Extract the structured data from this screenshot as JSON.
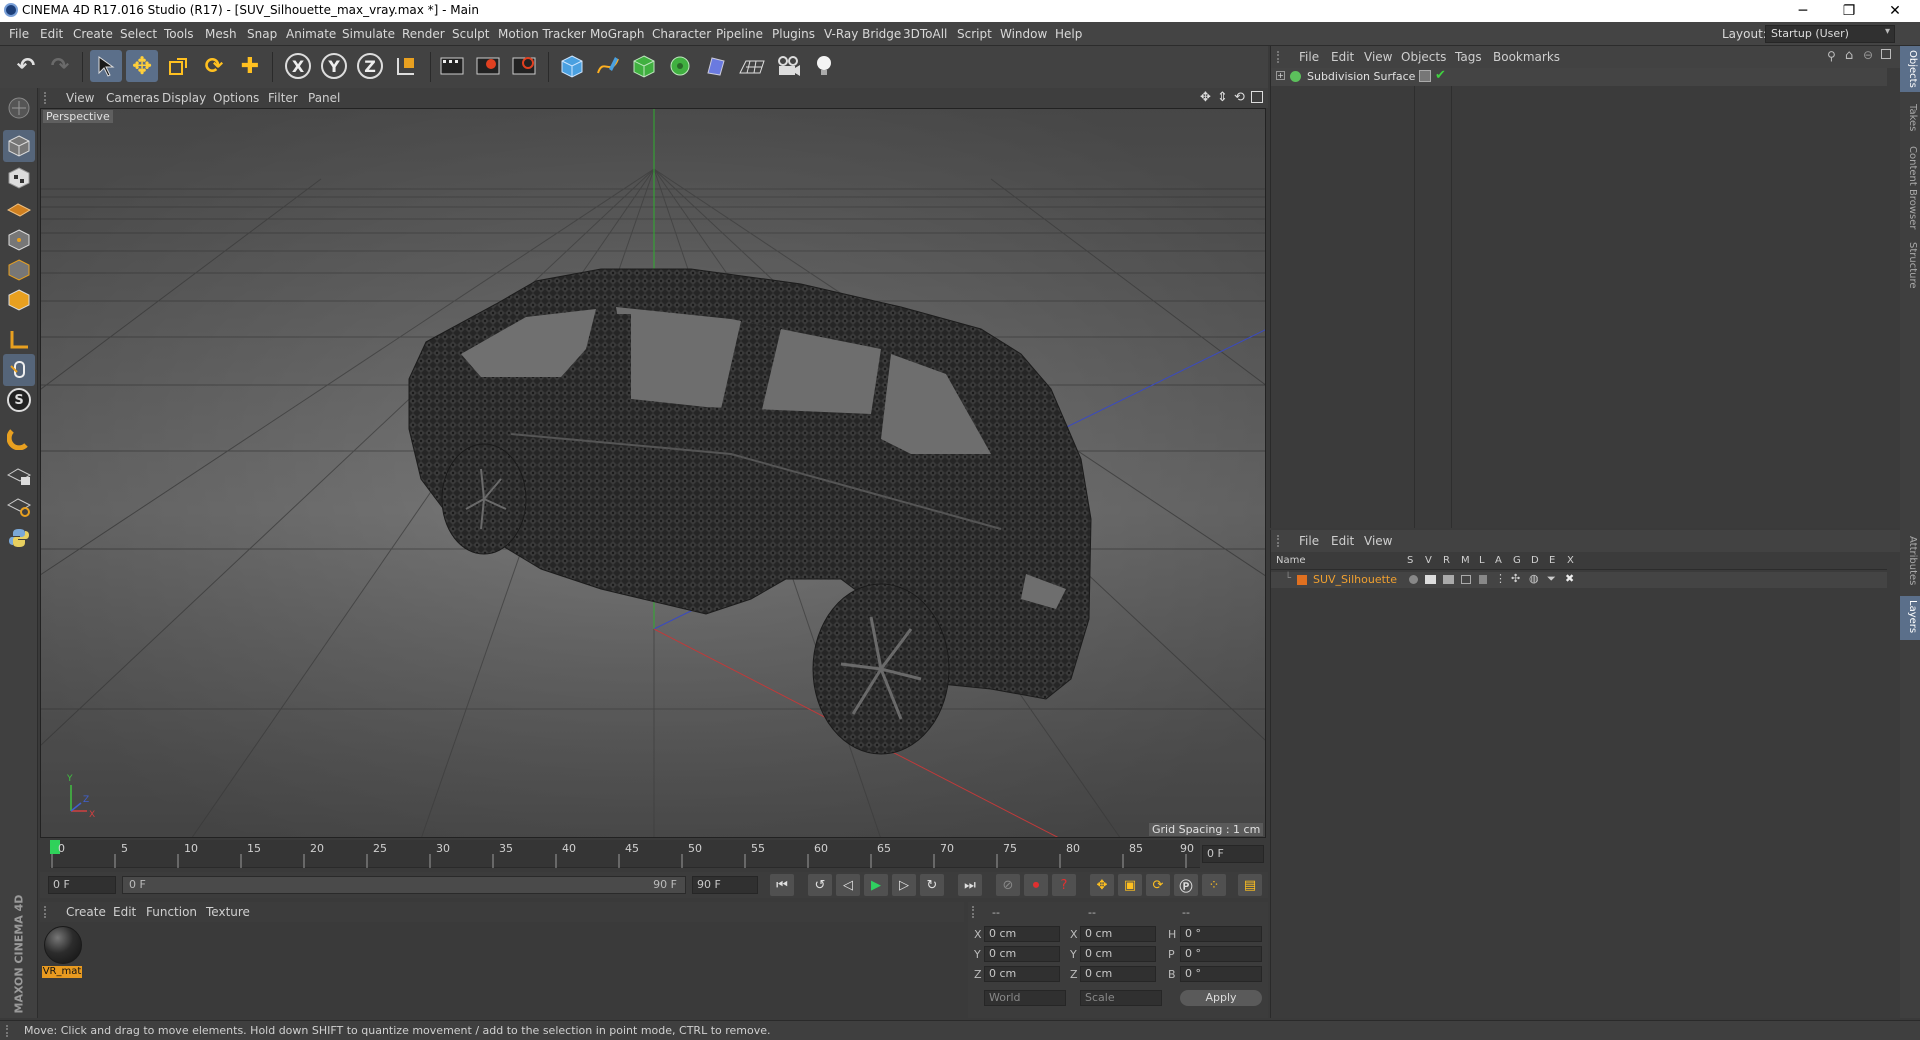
{
  "window": {
    "title": "CINEMA 4D R17.016 Studio (R17) - [SUV_Silhouette_max_vray.max *] - Main",
    "min": "─",
    "restore": "❐",
    "close": "✕"
  },
  "menubar": {
    "items": [
      "File",
      "Edit",
      "Create",
      "Select",
      "Tools",
      "Mesh",
      "Snap",
      "Animate",
      "Simulate",
      "Render",
      "Sculpt",
      "Motion Tracker",
      "MoGraph",
      "Character",
      "Pipeline",
      "Plugins",
      "V-Ray Bridge",
      "3DToAll",
      "Script",
      "Window",
      "Help"
    ],
    "layout_label": "Layout:",
    "layout_value": "Startup (User)"
  },
  "toolbar": {
    "axis_x": "X",
    "axis_y": "Y",
    "axis_z": "Z"
  },
  "viewport": {
    "menu": [
      "View",
      "Cameras",
      "Display",
      "Options",
      "Filter",
      "Panel"
    ],
    "label": "Perspective",
    "grid_spacing": "Grid Spacing : 1 cm"
  },
  "timeline": {
    "ticks": [
      "0",
      "5",
      "10",
      "15",
      "20",
      "25",
      "30",
      "35",
      "40",
      "45",
      "50",
      "55",
      "60",
      "65",
      "70",
      "75",
      "80",
      "85",
      "90"
    ],
    "end_frame": "0 F",
    "current": "0 F",
    "range_start": "0 F",
    "range_end": "90 F",
    "max": "90 F"
  },
  "material_manager": {
    "menu": [
      "Create",
      "Edit",
      "Function",
      "Texture"
    ],
    "material_name": "VR_mat"
  },
  "coords": {
    "header": [
      "--",
      "--",
      "--"
    ],
    "rows": [
      {
        "a": "X",
        "av": "0 cm",
        "b": "X",
        "bv": "0 cm",
        "c": "H",
        "cv": "0 °"
      },
      {
        "a": "Y",
        "av": "0 cm",
        "b": "Y",
        "bv": "0 cm",
        "c": "P",
        "cv": "0 °"
      },
      {
        "a": "Z",
        "av": "0 cm",
        "b": "Z",
        "bv": "0 cm",
        "c": "B",
        "cv": "0 °"
      }
    ],
    "mode1": "World",
    "mode2": "Scale",
    "apply": "Apply"
  },
  "object_manager": {
    "menu": [
      "File",
      "Edit",
      "View",
      "Objects",
      "Tags",
      "Bookmarks"
    ],
    "object": "Subdivision Surface"
  },
  "layer_manager": {
    "menu": [
      "File",
      "Edit",
      "View"
    ],
    "columns": [
      "Name",
      "S",
      "V",
      "R",
      "M",
      "L",
      "A",
      "G",
      "D",
      "E",
      "X"
    ],
    "layer": "SUV_Silhouette"
  },
  "side_tabs": [
    "Objects",
    "Takes",
    "Content Browser",
    "Structure",
    "Attributes",
    "Layers"
  ],
  "status": "Move: Click and drag to move elements. Hold down SHIFT to quantize movement / add to the selection in point mode, CTRL to remove.",
  "brand": "MAXON CINEMA 4D",
  "colors": {
    "accent": "#5b6f8a",
    "layer_name": "#f0a030",
    "object_green": "#5cc05c"
  }
}
